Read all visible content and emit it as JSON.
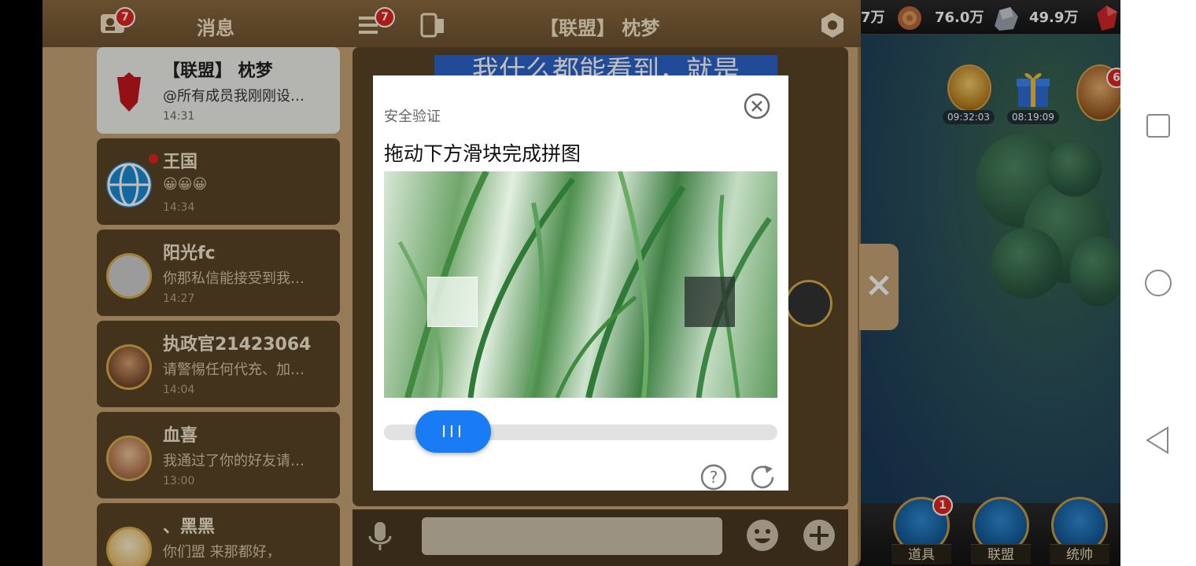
{
  "resources": [
    {
      "name": "res-partial",
      "value": "7万"
    },
    {
      "name": "wood",
      "value": "76.0万"
    },
    {
      "name": "stone",
      "value": "49.9万"
    }
  ],
  "timers": [
    {
      "label": "09:32:03"
    },
    {
      "label": "08:19:09"
    }
  ],
  "hero_badge_count": "6",
  "bottom_nav": [
    {
      "label": "道具",
      "badge": "1"
    },
    {
      "label": "联盟"
    },
    {
      "label": "统帅"
    }
  ],
  "chat": {
    "tab_messages": "消息",
    "messages_badge": "7",
    "list_badge": "7",
    "conversation_title": "【联盟】 枕梦",
    "banner_text": "我什么都能看到，就是",
    "conversations": [
      {
        "name": "【联盟】 枕梦",
        "message": "@所有成员我刚刚设…",
        "time": "14:31",
        "active": true
      },
      {
        "name": "王国",
        "message": "😀😀😀",
        "time": "14:34",
        "unread": true
      },
      {
        "name": "阳光fc",
        "message": "你那私信能接受到我…",
        "time": "14:27"
      },
      {
        "name": "执政官21423064",
        "message": "请警惕任何代充、加…",
        "time": "14:04"
      },
      {
        "name": "血喜",
        "message": "我通过了你的好友请…",
        "time": "13:00"
      },
      {
        "name": "、黑黑",
        "message": "你们盟 来那都好，",
        "time": ""
      }
    ]
  },
  "captcha": {
    "hint": "安全验证",
    "title": "拖动下方滑块完成拼图",
    "handle_label": "III",
    "slider_progress": 0.09
  },
  "colors": {
    "accent_blue": "#1a7cf5",
    "badge_red": "#e0261c",
    "panel_brown": "#5a4427"
  }
}
